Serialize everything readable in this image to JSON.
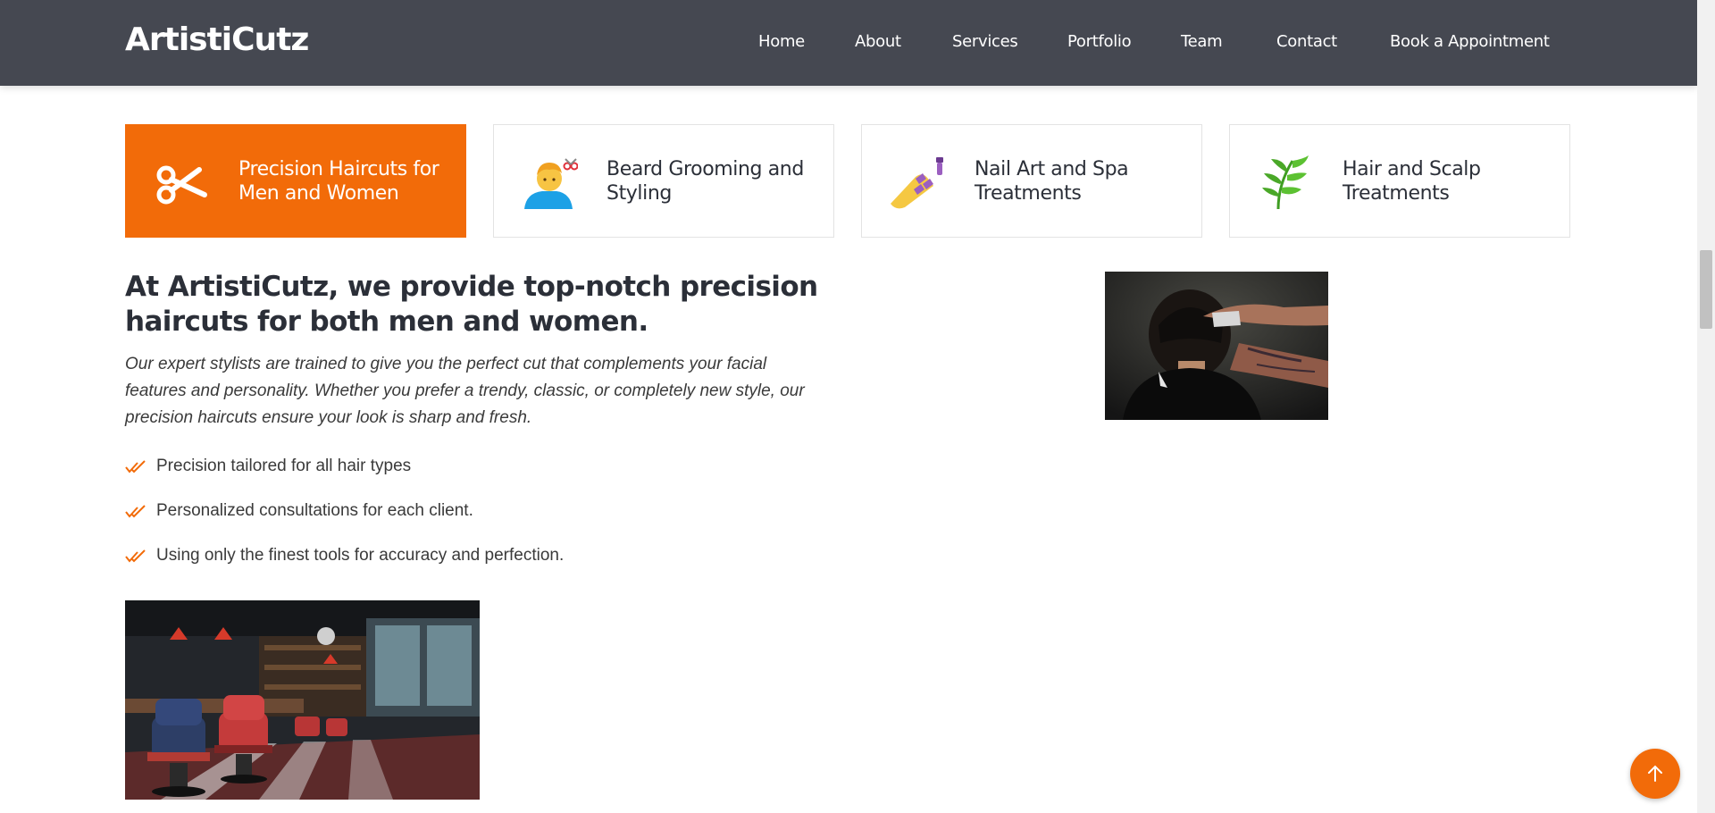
{
  "brand": {
    "logo": "ArtistiCutz"
  },
  "nav": {
    "items": [
      {
        "label": "Home"
      },
      {
        "label": "About"
      },
      {
        "label": "Services"
      },
      {
        "label": "Portfolio"
      },
      {
        "label": "Team"
      },
      {
        "label": "Contact"
      },
      {
        "label": "Book a Appointment"
      }
    ]
  },
  "services": {
    "active_index": 0,
    "tabs": [
      {
        "label": "Precision Haircuts for Men and Women",
        "icon": "scissors-icon"
      },
      {
        "label": "Beard Grooming and Styling",
        "icon": "haircut-person-icon"
      },
      {
        "label": "Nail Art and Spa Treatments",
        "icon": "nail-polish-icon"
      },
      {
        "label": "Hair and Scalp Treatments",
        "icon": "herb-leaf-icon"
      }
    ]
  },
  "content": {
    "headline": "At ArtistiCutz, we provide top-notch precision haircuts for both men and women.",
    "lead": "Our expert stylists are trained to give you the perfect cut that complements your facial features and personality. Whether you prefer a trendy, classic, or completely new style, our precision haircuts ensure your look is sharp and fresh.",
    "features": [
      "Precision tailored for all hair types",
      "Personalized consultations for each client.",
      "Using only the finest tools for accuracy and perfection."
    ]
  },
  "colors": {
    "accent": "#f26b09",
    "header_bg": "#454851",
    "text": "#2b2f38"
  }
}
